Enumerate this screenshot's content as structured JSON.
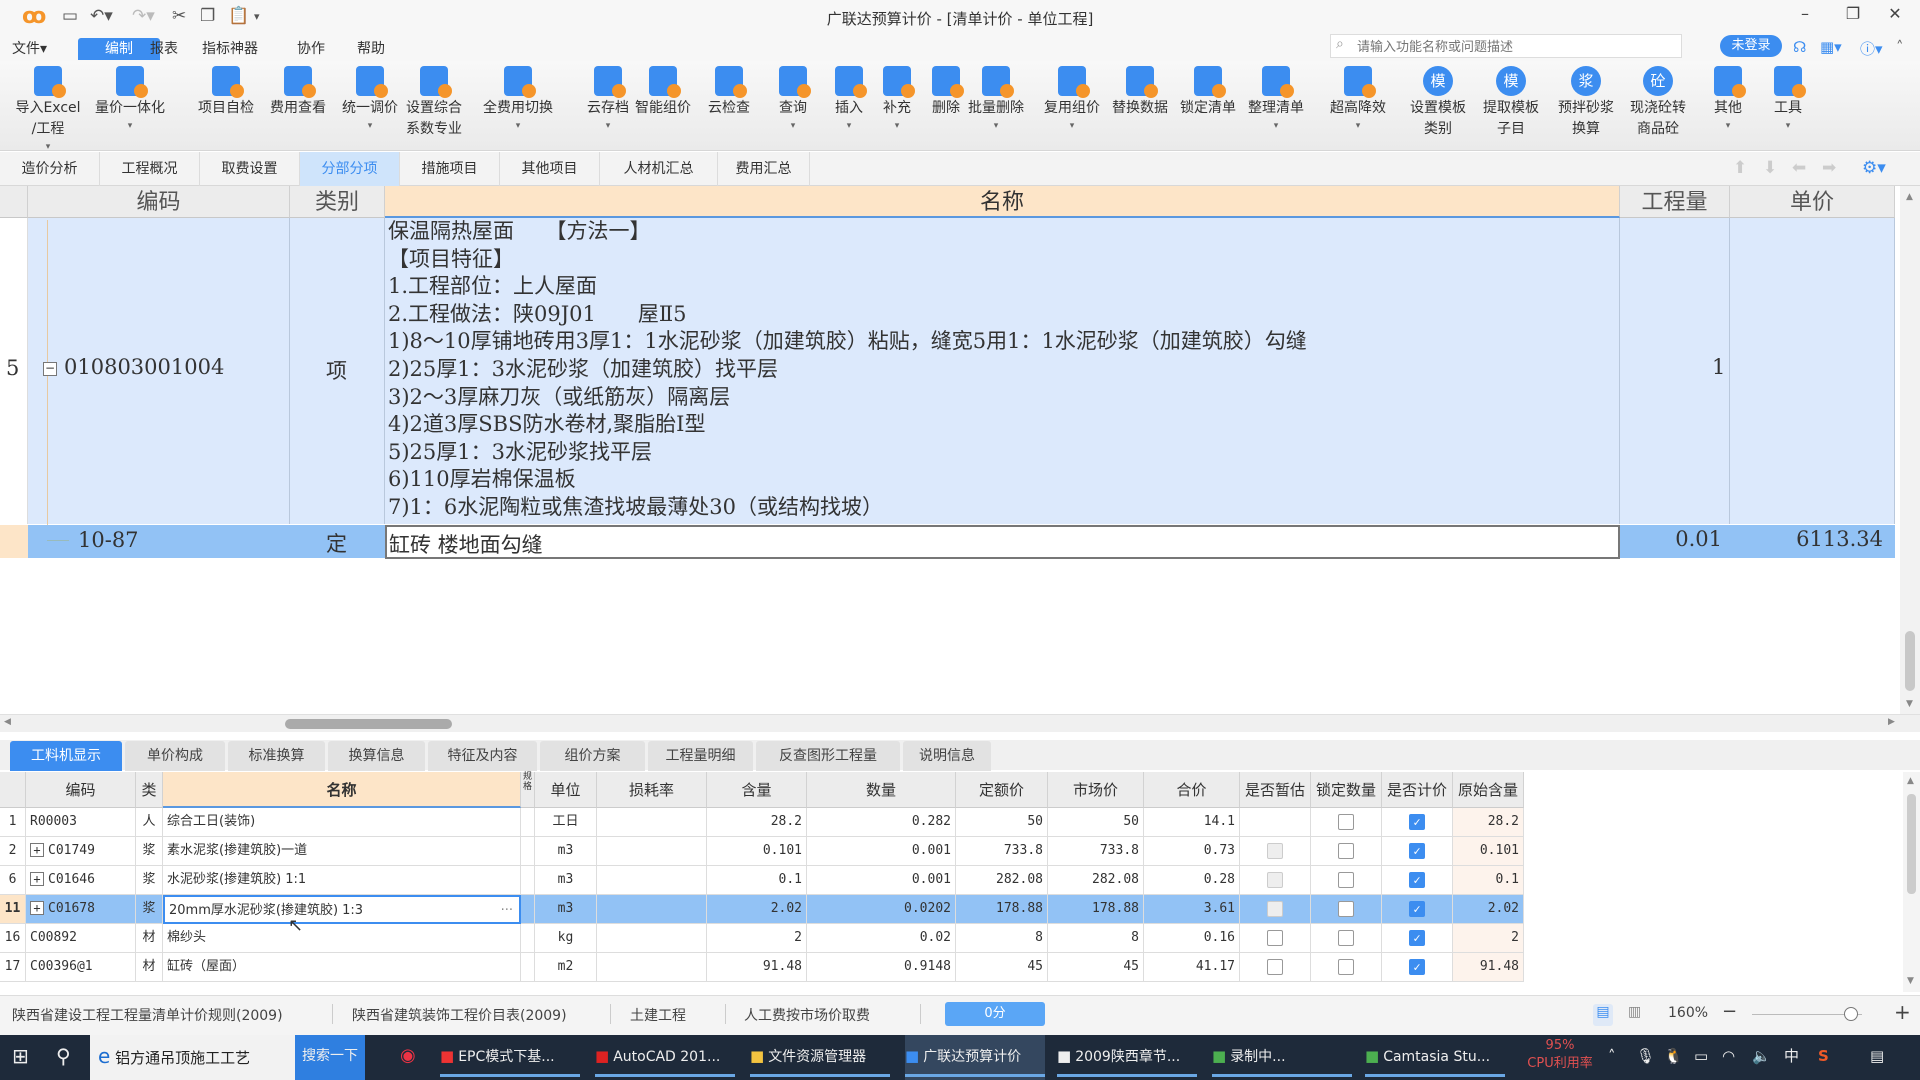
{
  "window": {
    "title": "广联达预算计价 - [清单计价 - 单位工程]"
  },
  "menu": {
    "items": [
      "文件▾",
      "编制",
      "报表",
      "指标神器",
      "协作",
      "帮助"
    ],
    "active": "编制"
  },
  "search": {
    "placeholder": "请输入功能名称或问题描述"
  },
  "login": {
    "label": "未登录"
  },
  "ribbon": {
    "buttons": [
      {
        "l1": "导入Excel",
        "l2": "/工程",
        "dd": true
      },
      {
        "l1": "量价一体化",
        "l2": "",
        "dd": true
      },
      {
        "l1": "项目自检",
        "l2": "",
        "dd": false
      },
      {
        "l1": "费用查看",
        "l2": "",
        "dd": false
      },
      {
        "l1": "统一调价",
        "l2": "",
        "dd": true
      },
      {
        "l1": "设置综合",
        "l2": "系数专业",
        "dd": false
      },
      {
        "l1": "全费用切换",
        "l2": "",
        "dd": true
      },
      {
        "l1": "云存档",
        "l2": "",
        "dd": true
      },
      {
        "l1": "智能组价",
        "l2": "",
        "dd": false
      },
      {
        "l1": "云检查",
        "l2": "",
        "dd": false
      },
      {
        "l1": "查询",
        "l2": "",
        "dd": true
      },
      {
        "l1": "插入",
        "l2": "",
        "dd": true
      },
      {
        "l1": "补充",
        "l2": "",
        "dd": true
      },
      {
        "l1": "删除",
        "l2": "",
        "dd": false
      },
      {
        "l1": "批量删除",
        "l2": "",
        "dd": true
      },
      {
        "l1": "复用组价",
        "l2": "",
        "dd": true
      },
      {
        "l1": "替换数据",
        "l2": "",
        "dd": false
      },
      {
        "l1": "锁定清单",
        "l2": "",
        "dd": false
      },
      {
        "l1": "整理清单",
        "l2": "",
        "dd": true
      },
      {
        "l1": "超高降效",
        "l2": "",
        "dd": true
      },
      {
        "l1": "设置模板",
        "l2": "类别",
        "dd": false
      },
      {
        "l1": "提取模板",
        "l2": "子目",
        "dd": false
      },
      {
        "l1": "预拌砂浆",
        "l2": "换算",
        "dd": false
      },
      {
        "l1": "现浇砼转",
        "l2": "商品砼",
        "dd": false
      },
      {
        "l1": "其他",
        "l2": "",
        "dd": true
      },
      {
        "l1": "工具",
        "l2": "",
        "dd": true
      }
    ]
  },
  "tabs": {
    "items": [
      "造价分析",
      "工程概况",
      "取费设置",
      "分部分项",
      "措施项目",
      "其他项目",
      "人材机汇总",
      "费用汇总"
    ],
    "active": "分部分项"
  },
  "grid": {
    "headers": {
      "code": "编码",
      "type": "类别",
      "name": "名称",
      "qty": "工程量",
      "price": "单价"
    },
    "rows": [
      {
        "num": "5",
        "code": "010803001004",
        "type": "项",
        "qty": "1",
        "price": "",
        "desc": [
          "保温隔热屋面　　【方法一】",
          "【项目特征】",
          "1.工程部位：上人屋面",
          "2.工程做法：陕09J01　　屋Ⅱ5",
          "1)8～10厚铺地砖用3厚1：1水泥砂浆（加建筑胶）粘贴，缝宽5用1：1水泥砂浆（加建筑胶）勾缝",
          "2)25厚1：3水泥砂浆（加建筑胶）找平层",
          "3)2～3厚麻刀灰（或纸筋灰）隔离层",
          "4)2道3厚SBS防水卷材,聚脂胎Ⅰ型",
          "5)25厚1：3水泥砂浆找平层",
          "6)110厚岩棉保温板",
          "7)1：6水泥陶粒或焦渣找坡最薄处30（或结构找坡）"
        ]
      },
      {
        "num": "",
        "code": "10-87",
        "type": "定",
        "name": "缸砖 楼地面勾缝",
        "qty": "0.01",
        "price": "6113.34"
      }
    ]
  },
  "bottom_tabs": {
    "items": [
      "工料机显示",
      "单价构成",
      "标准换算",
      "换算信息",
      "特征及内容",
      "组价方案",
      "工程量明细",
      "反查图形工程量",
      "说明信息"
    ],
    "active": "工料机显示"
  },
  "bottom_table": {
    "headers": [
      "编码",
      "类别",
      "名称",
      "规格",
      "单位",
      "损耗率",
      "含量",
      "数量",
      "定额价",
      "市场价",
      "合价",
      "是否暂估",
      "锁定数量",
      "是否计价",
      "原始含量"
    ],
    "rows": [
      {
        "num": "1",
        "expand": false,
        "code": "R00003",
        "type": "人",
        "name": "综合工日(装饰)",
        "unit": "工日",
        "loss": "",
        "content": "28.2",
        "qty": "0.282",
        "quota": "50",
        "market": "50",
        "total": "14.1",
        "est": "none",
        "lock": false,
        "priced": true,
        "orig": "28.2"
      },
      {
        "num": "2",
        "expand": true,
        "code": "C01749",
        "type": "浆",
        "name": "素水泥浆(掺建筑胶)一道",
        "unit": "m3",
        "loss": "",
        "content": "0.101",
        "qty": "0.001",
        "quota": "733.8",
        "market": "733.8",
        "total": "0.73",
        "est": "disabled",
        "lock": false,
        "priced": true,
        "orig": "0.101"
      },
      {
        "num": "6",
        "expand": true,
        "code": "C01646",
        "type": "浆",
        "name": "水泥砂浆(掺建筑胶) 1:1",
        "unit": "m3",
        "loss": "",
        "content": "0.1",
        "qty": "0.001",
        "quota": "282.08",
        "market": "282.08",
        "total": "0.28",
        "est": "disabled",
        "lock": false,
        "priced": true,
        "orig": "0.1"
      },
      {
        "num": "11",
        "expand": true,
        "code": "C01678",
        "type": "浆",
        "name": "20mm厚水泥砂浆(掺建筑胶) 1:3",
        "unit": "m3",
        "loss": "",
        "content": "2.02",
        "qty": "0.0202",
        "quota": "178.88",
        "market": "178.88",
        "total": "3.61",
        "est": "disabled",
        "lock": false,
        "priced": true,
        "orig": "2.02",
        "selected": true
      },
      {
        "num": "16",
        "expand": false,
        "code": "C00892",
        "type": "材",
        "name": "棉纱头",
        "unit": "kg",
        "loss": "",
        "content": "2",
        "qty": "0.02",
        "quota": "8",
        "market": "8",
        "total": "0.16",
        "est": "off",
        "lock": false,
        "priced": true,
        "orig": "2"
      },
      {
        "num": "17",
        "expand": false,
        "code": "C00396@1",
        "type": "材",
        "name": "缸砖（屋面）",
        "unit": "m2",
        "loss": "",
        "content": "91.48",
        "qty": "0.9148",
        "quota": "45",
        "market": "45",
        "total": "41.17",
        "est": "off",
        "lock": false,
        "priced": true,
        "orig": "91.48"
      }
    ]
  },
  "status": {
    "items": [
      "陕西省建设工程工程量清单计价规则(2009)",
      "陕西省建筑装饰工程价目表(2009)",
      "土建工程",
      "人工费按市场价取费"
    ],
    "score": "0分",
    "zoom": "160%",
    "zoom_fraction": 0.9
  },
  "taskbar": {
    "search_text": "铝方通吊顶施工工艺",
    "search_btn": "搜索一下",
    "apps": [
      "EPC模式下基...",
      "AutoCAD 201...",
      "文件资源管理器",
      "广联达预算计价",
      "2009陕西章节...",
      "录制中...",
      "Camtasia Stu..."
    ],
    "cpu": "95%",
    "cpu_label": "CPU利用率",
    "ime": "中"
  }
}
